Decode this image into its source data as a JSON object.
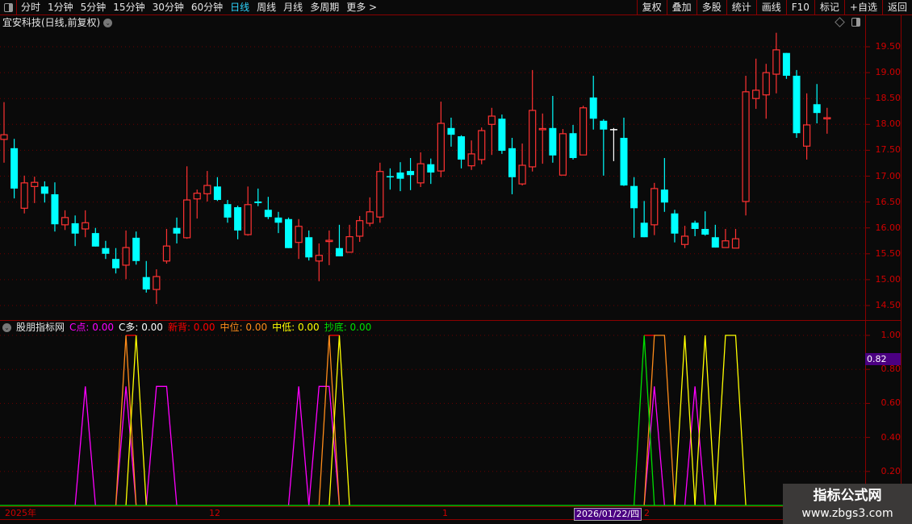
{
  "toolbar": {
    "periods": [
      "分时",
      "1分钟",
      "5分钟",
      "15分钟",
      "30分钟",
      "60分钟",
      "日线",
      "周线",
      "月线",
      "多周期",
      "更多 >"
    ],
    "active_period": "日线",
    "tools": [
      "复权",
      "叠加",
      "多股",
      "统计",
      "画线",
      "F10",
      "标记",
      "+自选",
      "返回"
    ]
  },
  "chart": {
    "title": "宜安科技(日线,前复权)",
    "price_ticks": [
      "19.50",
      "19.00",
      "18.50",
      "18.00",
      "17.50",
      "17.00",
      "16.50",
      "16.00",
      "15.50",
      "15.00",
      "14.50"
    ],
    "up_color": "#ff3232",
    "down_color": "#00ffff",
    "candles_ohlc": [
      [
        17.71,
        18.43,
        17.26,
        17.8
      ],
      [
        17.54,
        17.72,
        16.57,
        16.76
      ],
      [
        16.38,
        17.01,
        16.28,
        16.87
      ],
      [
        16.8,
        16.99,
        16.48,
        16.88
      ],
      [
        16.8,
        16.9,
        16.49,
        16.66
      ],
      [
        16.65,
        16.88,
        15.93,
        16.07
      ],
      [
        16.06,
        16.34,
        15.96,
        16.2
      ],
      [
        16.09,
        16.24,
        15.65,
        15.89
      ],
      [
        15.98,
        16.34,
        15.82,
        16.1
      ],
      [
        15.9,
        16.0,
        15.64,
        15.64
      ],
      [
        15.61,
        15.75,
        15.4,
        15.5
      ],
      [
        15.4,
        15.61,
        15.12,
        15.22
      ],
      [
        15.28,
        15.95,
        15.01,
        15.62
      ],
      [
        15.81,
        15.93,
        15.29,
        15.36
      ],
      [
        15.05,
        15.36,
        14.75,
        14.81
      ],
      [
        14.81,
        15.2,
        14.53,
        15.06
      ],
      [
        15.36,
        15.98,
        15.31,
        15.65
      ],
      [
        16.0,
        16.2,
        15.7,
        15.89
      ],
      [
        15.81,
        17.19,
        15.79,
        16.54
      ],
      [
        16.56,
        16.74,
        16.18,
        16.67
      ],
      [
        16.66,
        17.1,
        16.51,
        16.82
      ],
      [
        16.8,
        16.98,
        16.52,
        16.54
      ],
      [
        16.46,
        16.54,
        16.1,
        16.2
      ],
      [
        16.4,
        16.43,
        15.78,
        15.95
      ],
      [
        15.87,
        16.8,
        15.85,
        16.45
      ],
      [
        16.51,
        16.76,
        16.42,
        16.48
      ],
      [
        16.35,
        16.6,
        16.17,
        16.21
      ],
      [
        16.2,
        16.31,
        15.9,
        16.1
      ],
      [
        16.17,
        16.2,
        15.61,
        15.61
      ],
      [
        15.72,
        16.17,
        15.4,
        16.03
      ],
      [
        15.82,
        15.95,
        15.37,
        15.43
      ],
      [
        15.36,
        15.7,
        14.97,
        15.47
      ],
      [
        15.74,
        15.95,
        15.28,
        15.76
      ],
      [
        15.61,
        16.06,
        15.45,
        15.45
      ],
      [
        15.53,
        16.06,
        15.53,
        15.83
      ],
      [
        15.84,
        16.23,
        15.73,
        16.14
      ],
      [
        16.09,
        16.59,
        16.03,
        16.31
      ],
      [
        16.21,
        17.26,
        16.1,
        17.09
      ],
      [
        17.0,
        17.15,
        16.74,
        16.99
      ],
      [
        17.07,
        17.27,
        16.71,
        16.95
      ],
      [
        17.1,
        17.35,
        16.73,
        17.02
      ],
      [
        16.87,
        17.46,
        16.79,
        17.24
      ],
      [
        17.23,
        17.34,
        16.85,
        17.07
      ],
      [
        17.1,
        18.44,
        16.98,
        18.02
      ],
      [
        17.93,
        18.13,
        17.57,
        17.8
      ],
      [
        17.77,
        17.79,
        17.15,
        17.32
      ],
      [
        17.2,
        17.69,
        17.12,
        17.43
      ],
      [
        17.32,
        17.94,
        17.23,
        17.88
      ],
      [
        18.0,
        18.32,
        17.41,
        18.16
      ],
      [
        18.11,
        18.19,
        17.43,
        17.49
      ],
      [
        17.54,
        17.74,
        16.65,
        16.98
      ],
      [
        16.85,
        17.63,
        16.82,
        17.21
      ],
      [
        17.18,
        19.05,
        17.09,
        18.27
      ],
      [
        17.91,
        18.21,
        17.24,
        17.92
      ],
      [
        17.93,
        18.55,
        17.26,
        17.4
      ],
      [
        17.02,
        17.91,
        17.02,
        17.82
      ],
      [
        17.83,
        17.99,
        17.32,
        17.35
      ],
      [
        17.41,
        18.36,
        17.41,
        18.32
      ],
      [
        18.52,
        18.94,
        17.9,
        18.11
      ],
      [
        18.07,
        18.1,
        17.01,
        17.9
      ],
      [
        17.91,
        17.93,
        17.29,
        17.91
      ],
      [
        17.74,
        18.13,
        16.81,
        16.82
      ],
      [
        16.81,
        16.98,
        15.81,
        16.38
      ],
      [
        16.1,
        16.52,
        15.82,
        15.82
      ],
      [
        16.06,
        16.87,
        15.86,
        16.76
      ],
      [
        16.74,
        17.35,
        16.31,
        16.49
      ],
      [
        16.28,
        16.35,
        15.72,
        15.89
      ],
      [
        15.68,
        16.04,
        15.61,
        15.84
      ],
      [
        16.1,
        16.14,
        15.84,
        15.98
      ],
      [
        15.98,
        16.32,
        15.85,
        15.87
      ],
      [
        15.82,
        16.06,
        15.62,
        15.62
      ],
      [
        15.62,
        15.98,
        15.62,
        15.75
      ],
      [
        15.61,
        15.98,
        15.61,
        15.79
      ],
      [
        16.51,
        18.94,
        16.24,
        18.63
      ],
      [
        18.5,
        19.27,
        18.3,
        18.66
      ],
      [
        18.57,
        19.17,
        18.11,
        19.0
      ],
      [
        18.97,
        19.77,
        18.6,
        19.44
      ],
      [
        19.38,
        19.38,
        18.88,
        18.94
      ],
      [
        18.94,
        19.05,
        17.74,
        17.83
      ],
      [
        17.58,
        18.6,
        17.32,
        17.99
      ],
      [
        18.39,
        18.78,
        18.02,
        18.22
      ],
      [
        18.12,
        18.32,
        17.82,
        18.13
      ]
    ]
  },
  "indicator": {
    "name": "股朋指标网",
    "ticks": [
      "1.00",
      "0.80",
      "0.60",
      "0.40",
      "0.20"
    ],
    "cursor_value": "0.82",
    "series": [
      {
        "label": "C点: 0.00",
        "color": "#ff00ff",
        "segments": [
          [
            [
              7,
              0
            ],
            [
              8,
              0.7
            ],
            [
              9,
              0
            ]
          ],
          [
            [
              11,
              0
            ],
            [
              12,
              0.7
            ],
            [
              13,
              0
            ]
          ],
          [
            [
              14,
              0
            ],
            [
              15,
              0.7
            ],
            [
              16,
              0.7
            ],
            [
              17,
              0
            ]
          ],
          [
            [
              28,
              0
            ],
            [
              29,
              0.7
            ],
            [
              30,
              0
            ]
          ],
          [
            [
              30,
              0
            ],
            [
              31,
              0.7
            ],
            [
              32,
              0.7
            ],
            [
              33,
              0
            ]
          ],
          [
            [
              63,
              0
            ],
            [
              64,
              0.7
            ],
            [
              65,
              0
            ]
          ],
          [
            [
              67,
              0
            ],
            [
              68,
              0.7
            ],
            [
              69,
              0
            ]
          ]
        ]
      },
      {
        "label": "C多: 0.00",
        "color": "#ffffff",
        "segments": []
      },
      {
        "label": "新背: 0.00",
        "color": "#ff0000",
        "segments": [
          [
            [
              12,
              1
            ],
            [
              13,
              1
            ]
          ],
          [
            [
              32,
              1
            ],
            [
              33,
              1
            ]
          ],
          [
            [
              63,
              1
            ],
            [
              64,
              1
            ]
          ]
        ]
      },
      {
        "label": "中位: 0.00",
        "color": "#ff8c1a",
        "segments": [
          [
            [
              11,
              0
            ],
            [
              12,
              1
            ],
            [
              13,
              0
            ]
          ],
          [
            [
              31,
              0
            ],
            [
              32,
              1
            ],
            [
              33,
              0
            ]
          ],
          [
            [
              63,
              0
            ],
            [
              64,
              1
            ],
            [
              65,
              1
            ],
            [
              66,
              0
            ]
          ]
        ]
      },
      {
        "label": "中低: 0.00",
        "color": "#ffff00",
        "segments": [
          [
            [
              12,
              0
            ],
            [
              13,
              1
            ],
            [
              14,
              0
            ]
          ],
          [
            [
              32,
              0
            ],
            [
              33,
              1
            ],
            [
              34,
              0
            ]
          ],
          [
            [
              66,
              0
            ],
            [
              67,
              1
            ],
            [
              68,
              0
            ]
          ],
          [
            [
              68,
              0
            ],
            [
              69,
              1
            ],
            [
              70,
              0
            ]
          ],
          [
            [
              70,
              0
            ],
            [
              71,
              1
            ],
            [
              72,
              1
            ],
            [
              73,
              0
            ]
          ]
        ]
      },
      {
        "label": "抄底: 0.00",
        "color": "#00e000",
        "segments": [
          [
            [
              -1,
              0
            ],
            [
              77,
              0
            ]
          ],
          [
            [
              62,
              0
            ],
            [
              63,
              1
            ],
            [
              64,
              0
            ]
          ]
        ]
      }
    ]
  },
  "time_axis": {
    "labels": [
      "2025年",
      "12",
      "1",
      "2"
    ],
    "cursor_date": "2026/01/22/四"
  },
  "watermark": {
    "line1": "指标公式网",
    "line2": "www.zbgs3.com"
  }
}
